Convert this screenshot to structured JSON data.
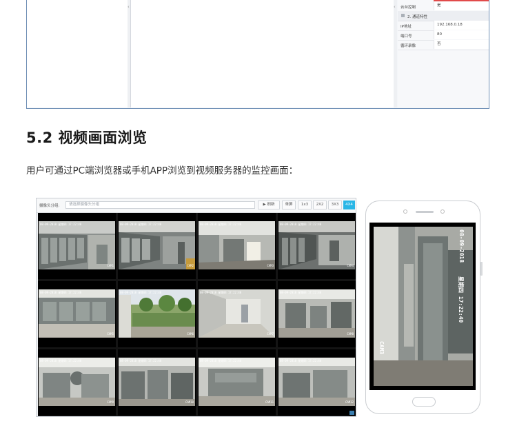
{
  "top_screenshot": {
    "properties": [
      {
        "key": "云台控制",
        "value": "是"
      },
      {
        "key": "IP地址",
        "value": "192.168.0.18"
      },
      {
        "key": "端口号",
        "value": "80"
      },
      {
        "key": "循环录像",
        "value": "否"
      }
    ],
    "group_label": "2. 通道特性",
    "accent_color": "#e14a4a"
  },
  "section": {
    "heading": "5.2 视频画面浏览",
    "paragraph": "用户可通过PC端浏览器或手机APP浏览到视频服务器的监控画面："
  },
  "viewer": {
    "toolbar": {
      "group_label": "摄像头分组:",
      "select_placeholder": "请选择摄像头分组",
      "play_label": "▶ 刷新",
      "fullscreen_label": "单屏",
      "layouts": [
        "1x3",
        "2X2",
        "3X3",
        "4X4"
      ],
      "active_layout_color": "#29b6e6"
    },
    "cells": [
      {
        "ts": "08-09-2018 星期四 17:22:40",
        "cam": "CAM1"
      },
      {
        "ts": "08-09-2018 星期四 17:22:40",
        "cam": "CAM2"
      },
      {
        "ts": "08-09-2018 星期四 17:22:40",
        "cam": "CAM3"
      },
      {
        "ts": "08-09-2018 星期四 17:22:40",
        "cam": "CAM4"
      },
      {
        "ts": "08-09-2018 星期四 17:22:40",
        "cam": "CAM5"
      },
      {
        "ts": "08-09-2018 星期四 17:22:40",
        "cam": "CAM6"
      },
      {
        "ts": "08-09-2018 星期四 17:22:40",
        "cam": "CAM7"
      },
      {
        "ts": "08-09-2018 星期四 17:22:40",
        "cam": "CAM8"
      },
      {
        "ts": "08-09-2018 星期四 17:22:40",
        "cam": "CAM9"
      },
      {
        "ts": "08-09-2018 星期四 17:22:40",
        "cam": "CAM10"
      },
      {
        "ts": "08-09-2018 星期四 17:22:40",
        "cam": "CAM11"
      },
      {
        "ts": "08-09-2018 星期四 17:22:40",
        "cam": "CAM12"
      }
    ]
  },
  "phone": {
    "osd_date": "08-09-2018",
    "osd_time": "星期四 17:22:40",
    "osd_cam": "CAM3"
  }
}
